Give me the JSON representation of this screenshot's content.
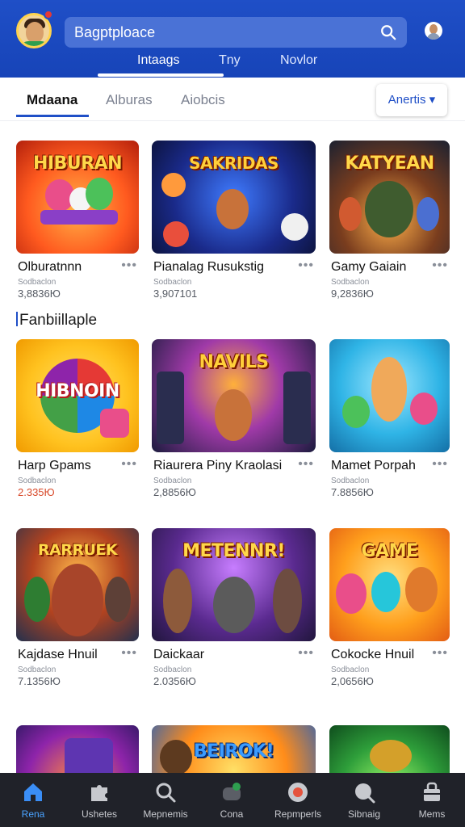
{
  "colors": {
    "header": "#1f4fc7",
    "accent": "#1f4fc7",
    "nav_bg": "#202229",
    "nav_active": "#4aa3ff"
  },
  "header": {
    "search_text": "Bagptploace",
    "tabs": [
      {
        "label": "Intaags",
        "active": true
      },
      {
        "label": "Tny",
        "active": false
      },
      {
        "label": "Novlor",
        "active": false
      }
    ]
  },
  "subtabs": {
    "items": [
      {
        "label": "Mdaana",
        "active": true
      },
      {
        "label": "Alburas",
        "active": false
      },
      {
        "label": "Aiobcis",
        "active": false
      }
    ],
    "sort_label": "Anertis ▾"
  },
  "sections": [
    {
      "title": ""
    },
    {
      "title": "Fanbiillaple"
    }
  ],
  "games": [
    {
      "thumb_text": "HIBURAN",
      "title": "Olburatnnn",
      "sub": "Sodbaclon",
      "meta": "3,8836Ю",
      "meta_red": false
    },
    {
      "thumb_text": "SAKRIDAS",
      "title": "Pianalag Rusukstig",
      "sub": "Sodbaclon",
      "meta": "3,907101",
      "meta_red": false
    },
    {
      "thumb_text": "KATYEAN",
      "title": "Gamy Gaiain",
      "sub": "Sodbaclon",
      "meta": "9,2836Ю",
      "meta_red": false
    },
    {
      "thumb_text": "HIBNOIN",
      "title": "Harp Gpams",
      "sub": "Sodbaclon",
      "meta": "2.335Ю",
      "meta_red": true
    },
    {
      "thumb_text": "NAVILS",
      "title": "Riaurera Piny Kraolasi",
      "sub": "Sodbaclon",
      "meta": "2,8856Ю",
      "meta_red": false
    },
    {
      "thumb_text": "",
      "title": "Mamet Porpah",
      "sub": "Sodbaclon",
      "meta": "7.8856Ю",
      "meta_red": false
    },
    {
      "thumb_text": "RARRUEK",
      "title": "Kajdase Hnuil",
      "sub": "Sodbaclon",
      "meta": "7.1356Ю",
      "meta_red": false
    },
    {
      "thumb_text": "METENNR!",
      "title": "Daickaar",
      "sub": "Sodbaclon",
      "meta": "2.0356Ю",
      "meta_red": false
    },
    {
      "thumb_text": "GAME",
      "title": "Cokocke Hnuil",
      "sub": "Sodbaclon",
      "meta": "2,0656Ю",
      "meta_red": false
    },
    {
      "thumb_text": "",
      "title": "",
      "sub": "",
      "meta": "",
      "meta_red": false
    },
    {
      "thumb_text": "BEIROK!",
      "title": "",
      "sub": "",
      "meta": "",
      "meta_red": false
    },
    {
      "thumb_text": "",
      "title": "",
      "sub": "",
      "meta": "",
      "meta_red": false
    }
  ],
  "more_glyph": "•••",
  "bottom_nav": [
    {
      "label": "Rena",
      "icon": "home-icon",
      "active": true
    },
    {
      "label": "Ushetes",
      "icon": "puzzle-icon",
      "active": false
    },
    {
      "label": "Mepnemis",
      "icon": "search-icon",
      "active": false
    },
    {
      "label": "Cona",
      "icon": "gamepad-icon",
      "active": false
    },
    {
      "label": "Repmperls",
      "icon": "target-icon",
      "active": false
    },
    {
      "label": "Sibnaig",
      "icon": "magnifier-icon",
      "active": false
    },
    {
      "label": "Mems",
      "icon": "store-icon",
      "active": false
    }
  ]
}
